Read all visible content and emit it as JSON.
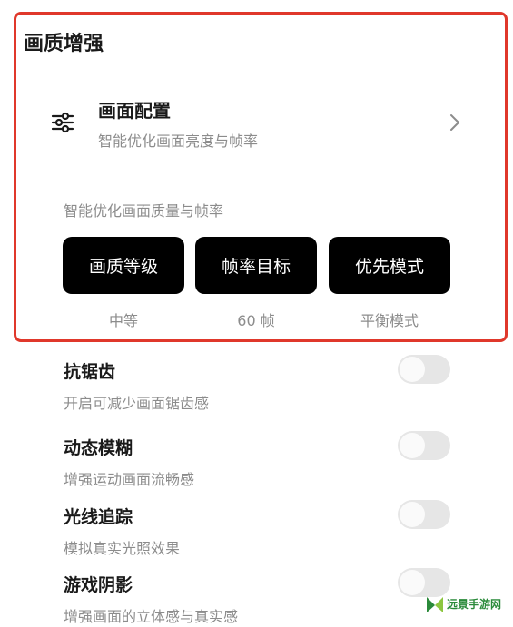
{
  "section": {
    "title": "画质增强"
  },
  "config": {
    "title": "画面配置",
    "subtitle": "智能优化画面亮度与帧率",
    "icon": "sliders-icon"
  },
  "caption": "智能优化画面质量与帧率",
  "options": [
    {
      "label": "画质等级",
      "value": "中等"
    },
    {
      "label": "帧率目标",
      "value": "60 帧"
    },
    {
      "label": "优先模式",
      "value": "平衡模式"
    }
  ],
  "toggles": [
    {
      "title": "抗锯齿",
      "desc": "开启可减少画面锯齿感",
      "on": false
    },
    {
      "title": "动态模糊",
      "desc": "增强运动画面流畅感",
      "on": false
    },
    {
      "title": "光线追踪",
      "desc": "模拟真实光照效果",
      "on": false
    },
    {
      "title": "游戏阴影",
      "desc": "增强画面的立体感与真实感",
      "on": false
    }
  ],
  "watermark": {
    "text": "远景手游网"
  },
  "colors": {
    "highlight": "#e0382b",
    "pill_bg": "#000000",
    "toggle_off": "#e6e6e6",
    "watermark": "#2a8a3a"
  }
}
